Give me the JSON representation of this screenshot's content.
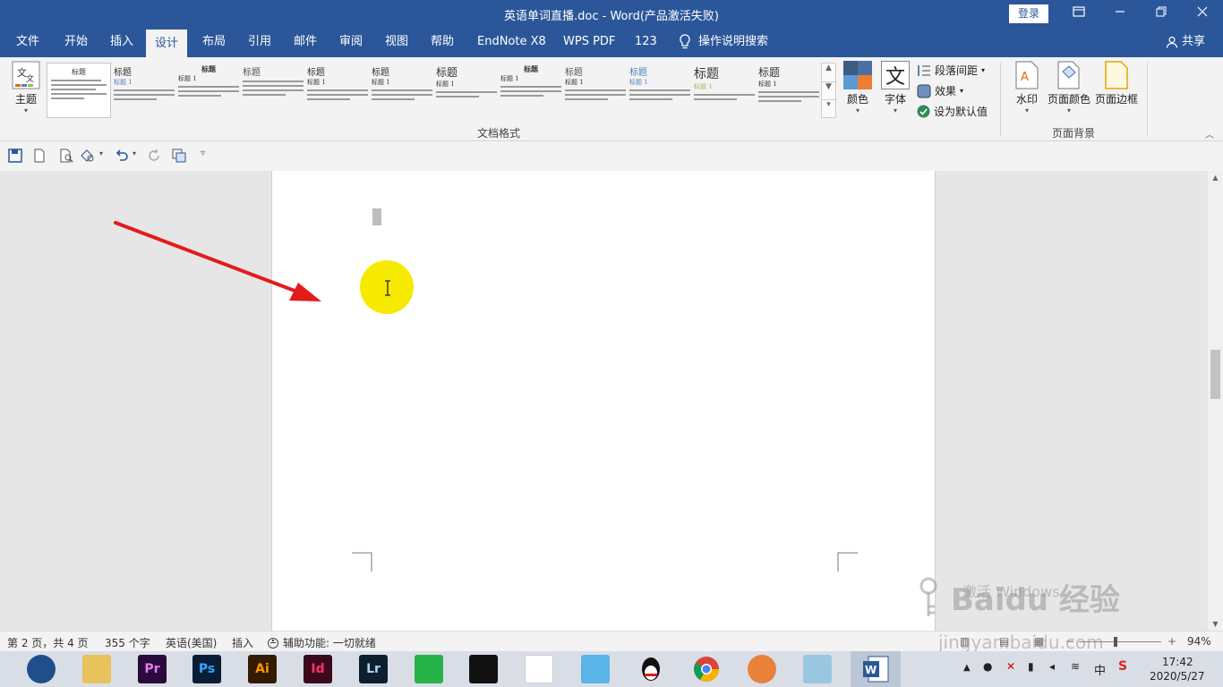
{
  "window": {
    "title": "英语单词直播.doc  -  Word(产品激活失败)",
    "login_label": "登录",
    "ribbon_display_icon": "ribbon-display-icon",
    "minimize_icon": "minimize-icon",
    "restore_icon": "restore-icon",
    "close_icon": "close-icon"
  },
  "tabs": [
    {
      "label": "文件"
    },
    {
      "label": "开始"
    },
    {
      "label": "插入"
    },
    {
      "label": "设计"
    },
    {
      "label": "布局"
    },
    {
      "label": "引用"
    },
    {
      "label": "邮件"
    },
    {
      "label": "审阅"
    },
    {
      "label": "视图"
    },
    {
      "label": "帮助"
    },
    {
      "label": "EndNote X8"
    },
    {
      "label": "WPS PDF"
    },
    {
      "label": "123"
    },
    {
      "label": "操作说明搜索"
    }
  ],
  "active_tab": "设计",
  "share_label": "共享",
  "ribbon": {
    "theme_label": "主题",
    "doc_format_group": "文档格式",
    "style_heading": "标题",
    "style_heading1": "标题 1",
    "colors_label": "颜色",
    "fonts_label": "字体",
    "paragraph_spacing": "段落间距",
    "effects": "效果",
    "set_default": "设为默认值",
    "page_bg_group": "页面背景",
    "watermark_label": "水印",
    "page_color_label": "页面颜色",
    "page_border_label": "页面边框"
  },
  "statusbar": {
    "page": "第 2 页，共 4 页",
    "words": "355 个字",
    "language": "英语(美国)",
    "mode": "插入",
    "accessibility": "辅助功能: 一切就绪",
    "zoom": "94%"
  },
  "taskbar": {
    "apps": [
      "Pr",
      "Ps",
      "Ai",
      "Id",
      "Lr"
    ],
    "time": "17:42",
    "date": "2020/5/27",
    "ime": "中"
  },
  "overlay": {
    "activate_text": "激活 Windows",
    "baidu_text": "Baidu 经验",
    "site": "jingyan.baidu.com"
  },
  "colors": {
    "title_bar": "#2b579a",
    "ribbon_bg": "#f3f3f3",
    "arrow": "#e31b1b",
    "cursor_highlight": "#f5ea00"
  }
}
